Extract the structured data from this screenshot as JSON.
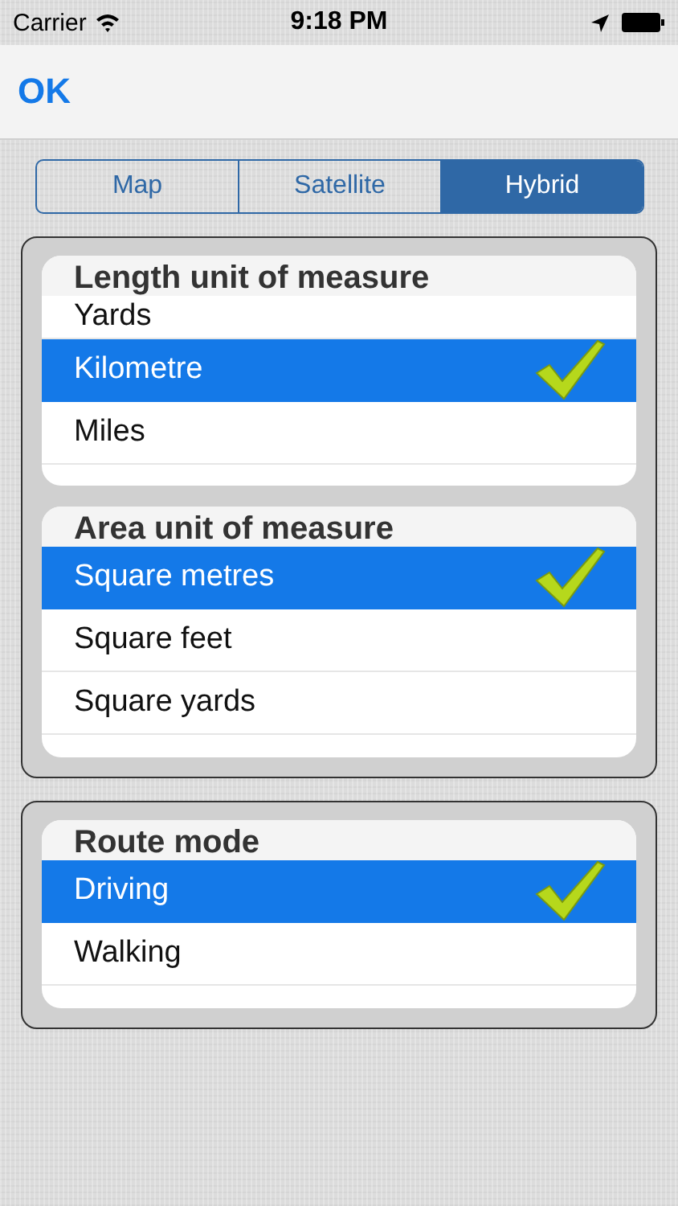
{
  "status_bar": {
    "carrier": "Carrier",
    "time": "9:18 PM"
  },
  "nav_bar": {
    "ok_button": "OK"
  },
  "map_type_tabs": [
    {
      "label": "Map",
      "selected": false
    },
    {
      "label": "Satellite",
      "selected": false
    },
    {
      "label": "Hybrid",
      "selected": true
    }
  ],
  "panels": [
    {
      "sections": [
        {
          "title": "Length unit of measure",
          "items": [
            {
              "label": "Yards",
              "selected": false
            },
            {
              "label": "Kilometre",
              "selected": true
            },
            {
              "label": "Miles",
              "selected": false
            }
          ]
        },
        {
          "title": "Area unit of measure",
          "items": [
            {
              "label": "Square metres",
              "selected": true
            },
            {
              "label": "Square feet",
              "selected": false
            },
            {
              "label": "Square yards",
              "selected": false
            }
          ]
        }
      ]
    },
    {
      "sections": [
        {
          "title": "Route mode",
          "items": [
            {
              "label": "Driving",
              "selected": true
            },
            {
              "label": "Walking",
              "selected": false
            }
          ]
        }
      ]
    }
  ]
}
